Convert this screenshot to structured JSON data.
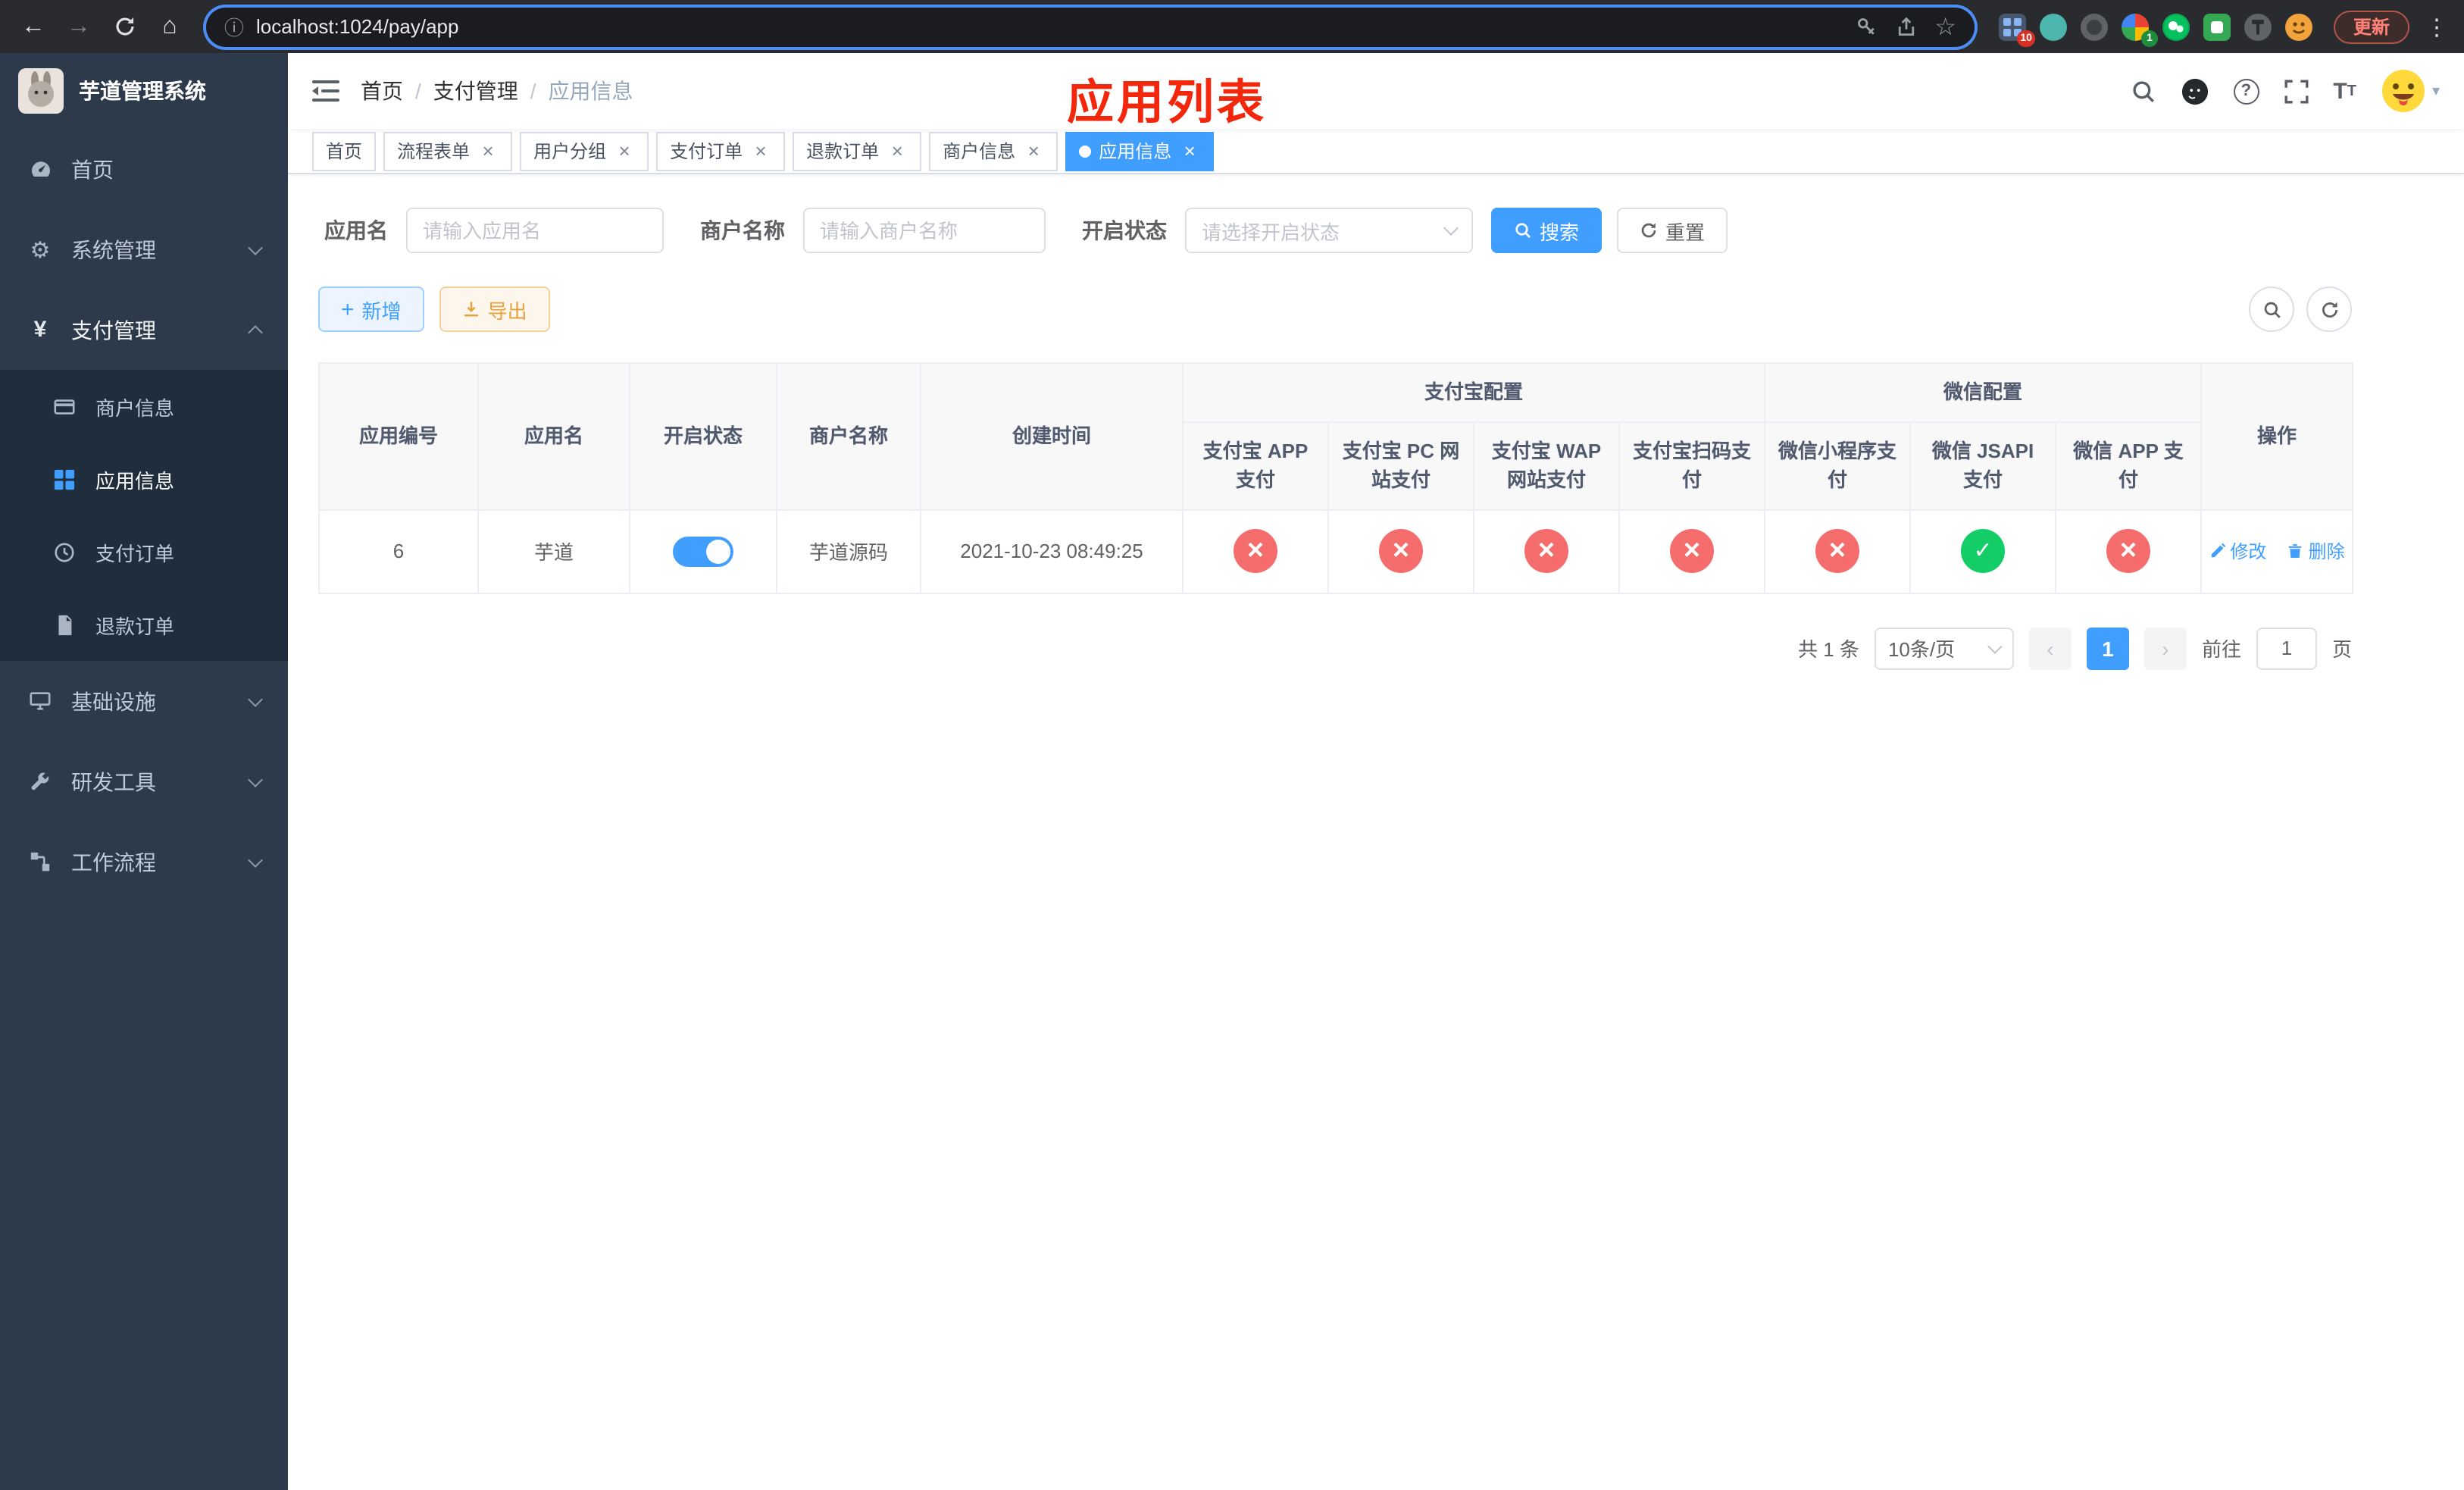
{
  "colors": {
    "accent": "#409eff",
    "success": "#13ce66",
    "danger": "#f56c6c",
    "warning": "#e6a23c",
    "sidebar_bg": "#2d3a4b",
    "submenu_bg": "#1f2d3d",
    "annotation": "#f2270c"
  },
  "browser": {
    "url": "localhost:1024/pay/app",
    "update_label": "更新",
    "extension_badge_1": "10",
    "extension_badge_2": "1"
  },
  "sidebar": {
    "logo_title": "芋道管理系统",
    "items": [
      {
        "label": "首页"
      },
      {
        "label": "系统管理"
      },
      {
        "label": "支付管理",
        "children": [
          {
            "label": "商户信息"
          },
          {
            "label": "应用信息"
          },
          {
            "label": "支付订单"
          },
          {
            "label": "退款订单"
          }
        ]
      },
      {
        "label": "基础设施"
      },
      {
        "label": "研发工具"
      },
      {
        "label": "工作流程"
      }
    ]
  },
  "header": {
    "breadcrumb": [
      "首页",
      "支付管理",
      "应用信息"
    ],
    "annotation": "应用列表"
  },
  "tabs": [
    {
      "label": "首页"
    },
    {
      "label": "流程表单"
    },
    {
      "label": "用户分组"
    },
    {
      "label": "支付订单"
    },
    {
      "label": "退款订单"
    },
    {
      "label": "商户信息"
    },
    {
      "label": "应用信息"
    }
  ],
  "filters": {
    "app_name_label": "应用名",
    "app_name_placeholder": "请输入应用名",
    "merchant_label": "商户名称",
    "merchant_placeholder": "请输入商户名称",
    "status_label": "开启状态",
    "status_placeholder": "请选择开启状态",
    "search_label": "搜索",
    "reset_label": "重置"
  },
  "toolbar": {
    "add_label": "新增",
    "export_label": "导出"
  },
  "table": {
    "columns": {
      "main": [
        "应用编号",
        "应用名",
        "开启状态",
        "商户名称",
        "创建时间"
      ],
      "alipay_group": "支付宝配置",
      "alipay": [
        "支付宝 APP 支付",
        "支付宝 PC 网站支付",
        "支付宝 WAP 网站支付",
        "支付宝扫码支付"
      ],
      "wechat_group": "微信配置",
      "wechat": [
        "微信小程序支付",
        "微信 JSAPI 支付",
        "微信 APP 支付"
      ],
      "action": "操作"
    },
    "rows": [
      {
        "id": "6",
        "name": "芋道",
        "enabled": true,
        "merchant": "芋道源码",
        "created": "2021-10-23 08:49:25",
        "pay_status": [
          false,
          false,
          false,
          false,
          false,
          true,
          false
        ],
        "actions": [
          "修改",
          "删除"
        ]
      }
    ]
  },
  "pagination": {
    "total": "共 1 条",
    "page_size": "10条/页",
    "page": "1",
    "goto_prefix": "前往",
    "goto_value": "1",
    "goto_suffix": "页"
  }
}
